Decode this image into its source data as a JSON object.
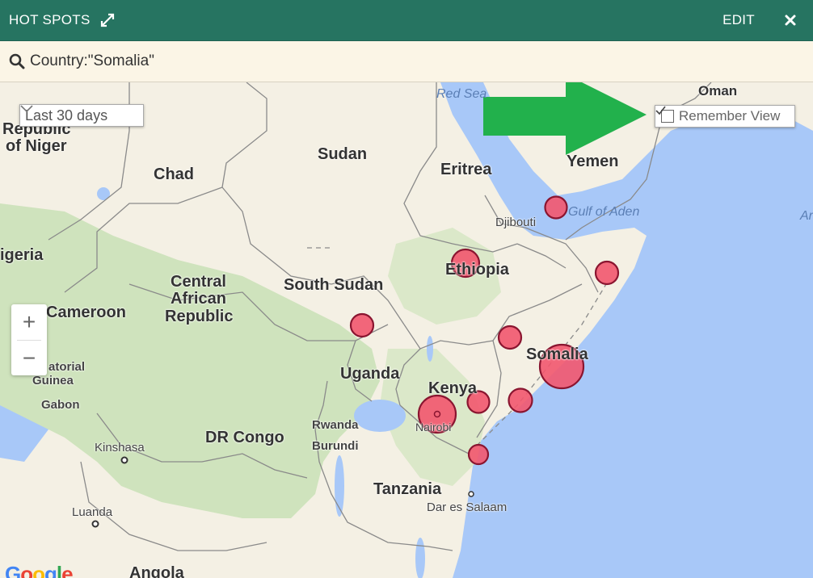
{
  "header": {
    "title": "HOT SPOTS",
    "edit_label": "EDIT",
    "bg_color": "#267461"
  },
  "search": {
    "query": "Country:\"Somalia\""
  },
  "controls": {
    "range_select": "Last 30 days",
    "remember_view": "Remember View",
    "remember_checked": true,
    "zoom_in": "+",
    "zoom_out": "−"
  },
  "labels": {
    "countries": {
      "republic_of_niger_1": "Republic",
      "republic_of_niger_2": "of Niger",
      "sudan": "Sudan",
      "chad": "Chad",
      "eritrea": "Eritrea",
      "yemen": "Yemen",
      "oman": "Oman",
      "djibouti": "Djibouti",
      "nigeria": "igeria",
      "ethiopia": "Ethiopia",
      "car_1": "Central",
      "car_2": "African",
      "car_3": "Republic",
      "south_sudan": "South Sudan",
      "cameroon": "Cameroon",
      "somalia": "Somalia",
      "uganda": "Uganda",
      "kenya": "Kenya",
      "eq_guinea_1": "atorial",
      "eq_guinea_2": "Guinea",
      "gabon": "Gabon",
      "rwanda": "Rwanda",
      "burundi": "Burundi",
      "dr_congo": "DR Congo",
      "tanzania": "Tanzania",
      "angola": "Angola"
    },
    "cities": {
      "nairobi": "Nairobi",
      "kinshasa": "Kinshasa",
      "luanda": "Luanda",
      "dar_es_salaam": "Dar es Salaam"
    },
    "water": {
      "red_sea": "Red Sea",
      "gulf_of_aden": "Gulf of Aden",
      "arabian": "Ar"
    },
    "attribution": "Google"
  },
  "colors": {
    "land": "#f4f0e4",
    "green_land": "#cfe3bd",
    "water": "#a8c8f8",
    "hotspot_fill": "#f2566e",
    "hotspot_stroke": "#8a1530",
    "arrow": "#22b14c"
  },
  "hotspots": [
    {
      "place": "Gulf of Aden coast",
      "size": "small"
    },
    {
      "place": "Ethiopia",
      "size": "medium"
    },
    {
      "place": "Somalia north-east",
      "size": "small"
    },
    {
      "place": "South Sudan",
      "size": "small"
    },
    {
      "place": "Somalia west",
      "size": "small"
    },
    {
      "place": "Somalia",
      "size": "large"
    },
    {
      "place": "Kenya east",
      "size": "small"
    },
    {
      "place": "Kenya",
      "size": "small"
    },
    {
      "place": "Nairobi",
      "size": "large"
    },
    {
      "place": "Kenya coast",
      "size": "small"
    }
  ]
}
